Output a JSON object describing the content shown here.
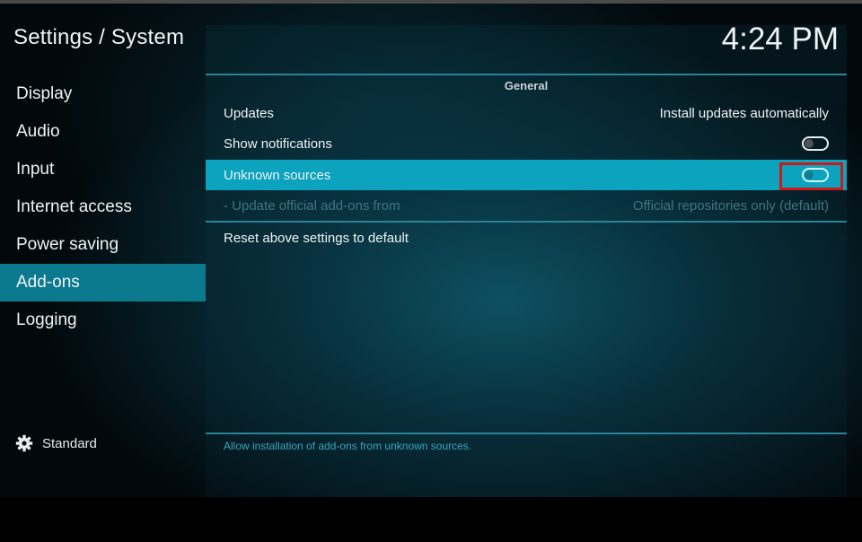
{
  "header": {
    "title": "Settings / System",
    "clock": "4:24 PM"
  },
  "sidebar": {
    "items": [
      {
        "label": "Display"
      },
      {
        "label": "Audio"
      },
      {
        "label": "Input"
      },
      {
        "label": "Internet access"
      },
      {
        "label": "Power saving"
      },
      {
        "label": "Add-ons",
        "active": true
      },
      {
        "label": "Logging"
      }
    ],
    "level": {
      "label": "Standard",
      "icon": "gear-icon"
    }
  },
  "main": {
    "section": "General",
    "settings": [
      {
        "label": "Updates",
        "value": "Install updates automatically"
      },
      {
        "label": "Show notifications",
        "type": "toggle",
        "state": "off"
      },
      {
        "label": "Unknown sources",
        "type": "toggle",
        "state": "off",
        "focused": true
      },
      {
        "label": "- Update official add-ons from",
        "value": "Official repositories only (default)",
        "disabled": true
      }
    ],
    "reset_label": "Reset above settings to default",
    "help_text": "Allow installation of add-ons from unknown sources."
  },
  "colors": {
    "accent": "#0b7a8f",
    "focus": "#0ba3bd",
    "annotation": "#cc1a1a"
  }
}
